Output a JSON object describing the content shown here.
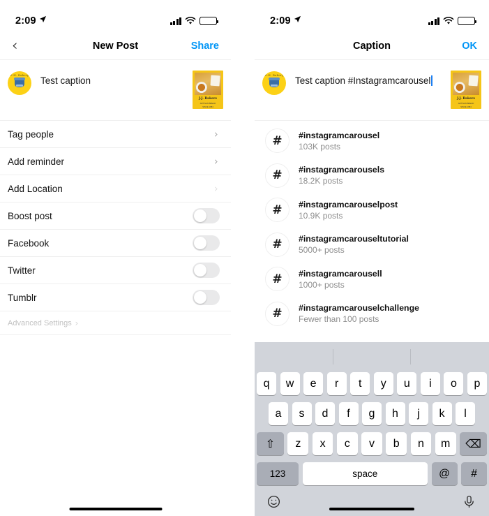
{
  "left_screen": {
    "status_bar": {
      "time": "2:09",
      "location_icon": "location-arrow-icon",
      "battery_level": "50"
    },
    "nav": {
      "back_icon": "chevron-left-icon",
      "title": "New Post",
      "action": "Share",
      "action_color": "#0095f6"
    },
    "composer": {
      "avatar_name": "user-avatar",
      "avatar_top_text": "E.H. Bakery",
      "caption": "Test caption",
      "thumbnail": {
        "name": "post-thumbnail",
        "title": "J.J. Bakers",
        "line2": "ARTISAN BREAD",
        "line3": "SINCE 1984"
      }
    },
    "options": [
      {
        "label": "Tag people",
        "type": "chevron",
        "dim": false
      },
      {
        "label": "Add reminder",
        "type": "chevron",
        "dim": false
      },
      {
        "label": "Add Location",
        "type": "chevron",
        "dim": true
      },
      {
        "label": "Boost post",
        "type": "toggle",
        "on": false
      },
      {
        "label": "Facebook",
        "type": "toggle",
        "on": false
      },
      {
        "label": "Twitter",
        "type": "toggle",
        "on": false
      },
      {
        "label": "Tumblr",
        "type": "toggle",
        "on": false
      }
    ],
    "advanced_settings": {
      "label": "Advanced Settings",
      "chevron": "›"
    }
  },
  "right_screen": {
    "status_bar": {
      "time": "2:09",
      "location_icon": "location-arrow-icon",
      "battery_level": "50"
    },
    "nav": {
      "title": "Caption",
      "action": "OK",
      "action_color": "#0095f6"
    },
    "composer": {
      "caption": "Test caption #Instagramcarousel",
      "thumbnail": {
        "name": "post-thumbnail",
        "title": "J.J. Bakers",
        "line2": "ARTISAN BREAD",
        "line3": "SINCE 1984"
      }
    },
    "hashtag_suggestions": [
      {
        "icon": "hash-icon",
        "tag": "#instagramcarousel",
        "count": "103K posts"
      },
      {
        "icon": "hash-icon",
        "tag": "#instagramcarousels",
        "count": "18.2K posts"
      },
      {
        "icon": "hash-icon",
        "tag": "#instagramcarouselpost",
        "count": "10.9K posts"
      },
      {
        "icon": "hash-icon",
        "tag": "#instagramcarouseltutorial",
        "count": "5000+ posts"
      },
      {
        "icon": "hash-icon",
        "tag": "#instagramcarousell",
        "count": "1000+ posts"
      },
      {
        "icon": "hash-icon",
        "tag": "#instagramcarouselchallenge",
        "count": "Fewer than 100 posts"
      }
    ],
    "keyboard": {
      "predictive_suggestions": [
        "",
        "",
        ""
      ],
      "row1": [
        "q",
        "w",
        "e",
        "r",
        "t",
        "y",
        "u",
        "i",
        "o",
        "p"
      ],
      "row2": [
        "a",
        "s",
        "d",
        "f",
        "g",
        "h",
        "j",
        "k",
        "l"
      ],
      "row3": {
        "shift": "⇧",
        "letters": [
          "z",
          "x",
          "c",
          "v",
          "b",
          "n",
          "m"
        ],
        "delete": "⌫"
      },
      "row4": {
        "numbers": "123",
        "space": "space",
        "at": "@",
        "hash": "#"
      },
      "bottom": {
        "emoji": "☺",
        "mic": "mic-icon"
      }
    }
  }
}
